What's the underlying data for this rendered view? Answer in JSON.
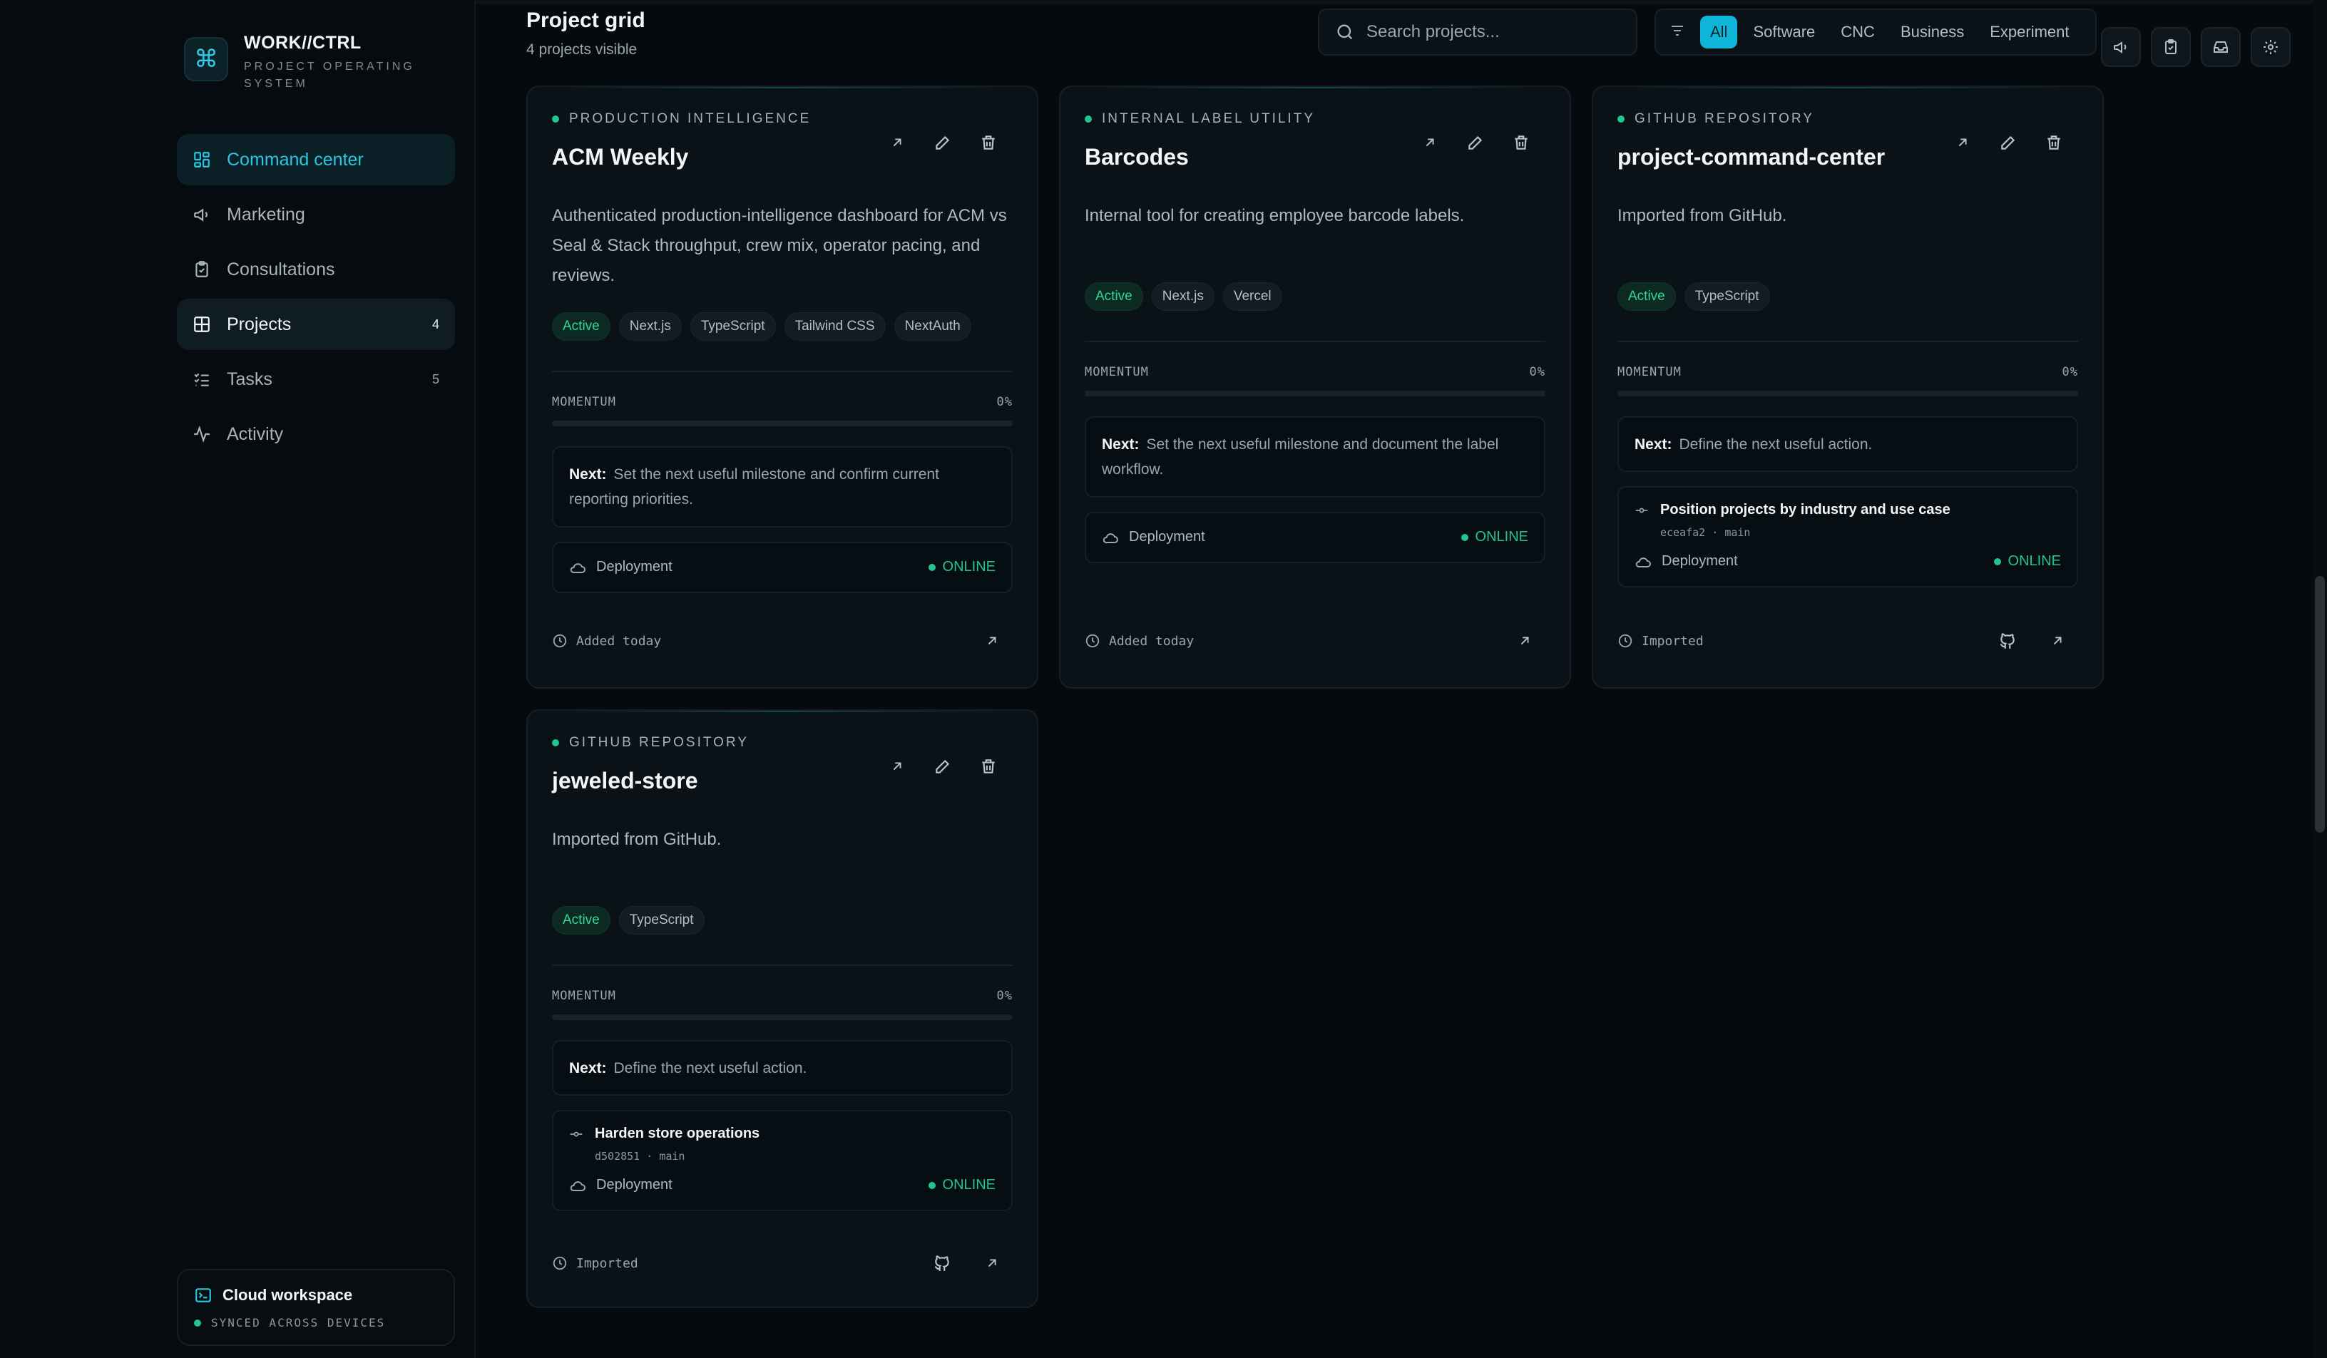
{
  "brand": {
    "name": "WORK//CTRL",
    "subtitle": "PROJECT OPERATING SYSTEM"
  },
  "sidebar": {
    "items": [
      {
        "label": "Command center",
        "icon": "dashboard-icon",
        "count": ""
      },
      {
        "label": "Marketing",
        "icon": "megaphone-icon",
        "count": ""
      },
      {
        "label": "Consultations",
        "icon": "clipboard-icon",
        "count": ""
      },
      {
        "label": "Projects",
        "icon": "grid-icon",
        "count": "4"
      },
      {
        "label": "Tasks",
        "icon": "list-check-icon",
        "count": "5"
      },
      {
        "label": "Activity",
        "icon": "activity-icon",
        "count": ""
      }
    ],
    "workspace": {
      "title": "Cloud workspace",
      "status": "SYNCED ACROSS DEVICES"
    }
  },
  "header": {
    "title": "Project grid",
    "subtitle": "4 projects visible",
    "search_placeholder": "Search projects...",
    "filters": [
      "All",
      "Software",
      "CNC",
      "Business",
      "Experiment"
    ],
    "active_filter": "All"
  },
  "labels": {
    "momentum": "MOMENTUM",
    "next": "Next:",
    "deployment": "Deployment",
    "online": "ONLINE"
  },
  "colors": {
    "accent": "#0fb6d9",
    "success": "#22c58b",
    "background": "#050a0e"
  },
  "cards": [
    {
      "kind": "PRODUCTION INTELLIGENCE",
      "title": "ACM Weekly",
      "description": "Authenticated production-intelligence dashboard for ACM vs Seal & Stack throughput, crew mix, operator pacing, and reviews.",
      "status": "Active",
      "tags": [
        "Next.js",
        "TypeScript",
        "Tailwind CSS",
        "NextAuth"
      ],
      "momentum": "0%",
      "momentum_value": 0,
      "next": "Set the next useful milestone and confirm current reporting priorities.",
      "deployment_status": "ONLINE",
      "footer": "Added today"
    },
    {
      "kind": "INTERNAL LABEL UTILITY",
      "title": "Barcodes",
      "description": "Internal tool for creating employee barcode labels.",
      "status": "Active",
      "tags": [
        "Next.js",
        "Vercel"
      ],
      "momentum": "0%",
      "momentum_value": 0,
      "next": "Set the next useful milestone and document the label workflow.",
      "deployment_status": "ONLINE",
      "footer": "Added today"
    },
    {
      "kind": "GITHUB REPOSITORY",
      "title": "project-command-center",
      "description": "Imported from GitHub.",
      "status": "Active",
      "tags": [
        "TypeScript"
      ],
      "momentum": "0%",
      "momentum_value": 0,
      "next": "Define the next useful action.",
      "commit": {
        "title": "Position projects by industry and use case",
        "hash": "eceafa2",
        "branch": "main"
      },
      "deployment_status": "ONLINE",
      "footer": "Imported"
    },
    {
      "kind": "GITHUB REPOSITORY",
      "title": "jeweled-store",
      "description": "Imported from GitHub.",
      "status": "Active",
      "tags": [
        "TypeScript"
      ],
      "momentum": "0%",
      "momentum_value": 0,
      "next": "Define the next useful action.",
      "commit": {
        "title": "Harden store operations",
        "hash": "d502851",
        "branch": "main"
      },
      "deployment_status": "ONLINE",
      "footer": "Imported"
    }
  ]
}
